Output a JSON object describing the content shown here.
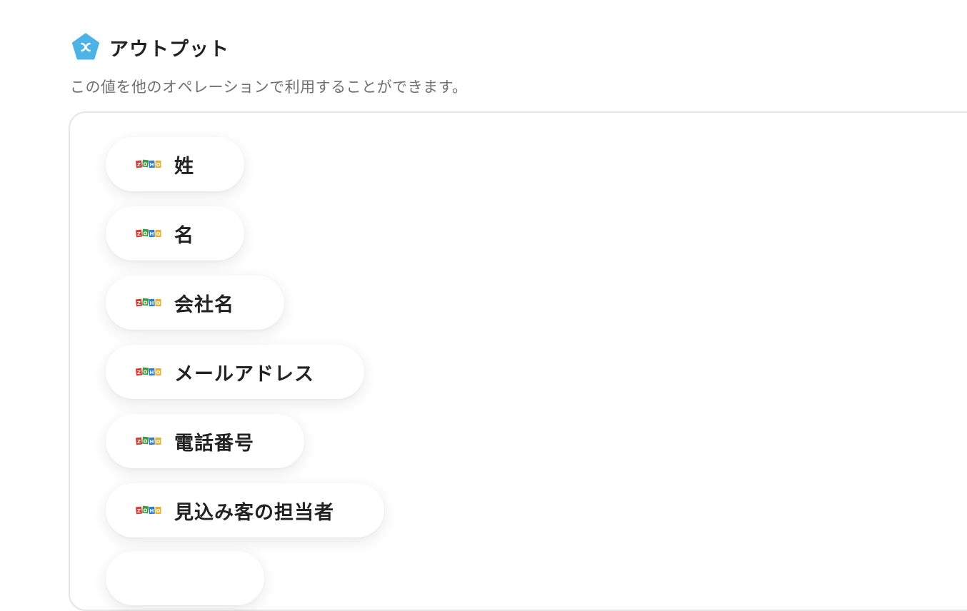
{
  "header": {
    "title": "アウトプット",
    "icon": "yoom-pentagon-icon",
    "icon_color": "#4db3e6"
  },
  "subtitle": "この値を他のオペレーションで利用することができます。",
  "outputs": [
    {
      "label": "姓",
      "icon": "zoho-logo-icon"
    },
    {
      "label": "名",
      "icon": "zoho-logo-icon"
    },
    {
      "label": "会社名",
      "icon": "zoho-logo-icon"
    },
    {
      "label": "メールアドレス",
      "icon": "zoho-logo-icon"
    },
    {
      "label": "電話番号",
      "icon": "zoho-logo-icon"
    },
    {
      "label": "見込み客の担当者",
      "icon": "zoho-logo-icon"
    },
    {
      "label": "",
      "icon": "zoho-logo-icon"
    }
  ],
  "colors": {
    "zoho_red": "#d7382f",
    "zoho_green": "#3f9b45",
    "zoho_blue": "#2f7cc4",
    "zoho_yellow": "#e7b12e"
  }
}
